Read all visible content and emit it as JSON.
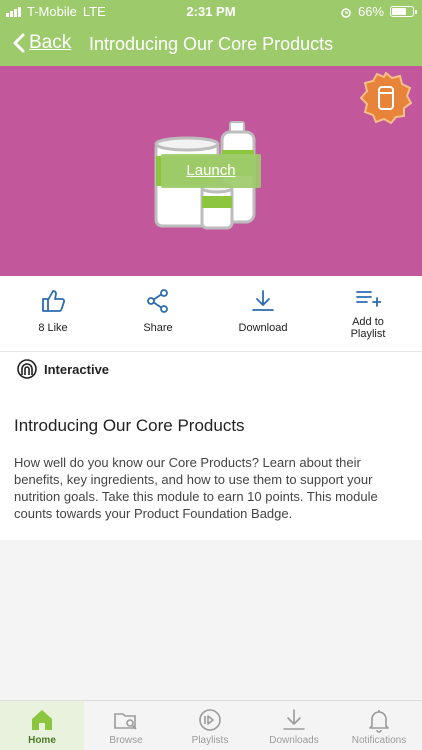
{
  "status_bar": {
    "carrier": "T-Mobile",
    "network": "LTE",
    "time": "2:31 PM",
    "battery": "66%"
  },
  "nav": {
    "back_label": "Back",
    "title": "Introducing Our Core Products"
  },
  "hero": {
    "launch_label": "Launch",
    "background_color": "#c2579c",
    "accent_color": "#9dcb6b"
  },
  "actions": [
    {
      "label": "8 Like",
      "icon": "thumbs-up-icon"
    },
    {
      "label": "Share",
      "icon": "share-icon"
    },
    {
      "label": "Download",
      "icon": "download-icon"
    },
    {
      "label": "Add to Playlist",
      "icon": "add-to-playlist-icon"
    }
  ],
  "module": {
    "type_label": "Interactive",
    "title": "Introducing Our Core Products",
    "description": "How well do you know our Core Products? Learn about their benefits, key ingredients, and how to use them to support your nutrition goals. Take this module to earn 10 points. This module counts towards your Product Foundation Badge."
  },
  "tabs": [
    {
      "label": "Home",
      "icon": "home-icon",
      "active": true
    },
    {
      "label": "Browse",
      "icon": "browse-icon",
      "active": false
    },
    {
      "label": "Playlists",
      "icon": "playlists-icon",
      "active": false
    },
    {
      "label": "Downloads",
      "icon": "downloads-icon",
      "active": false
    },
    {
      "label": "Notifications",
      "icon": "bell-icon",
      "active": false
    }
  ]
}
